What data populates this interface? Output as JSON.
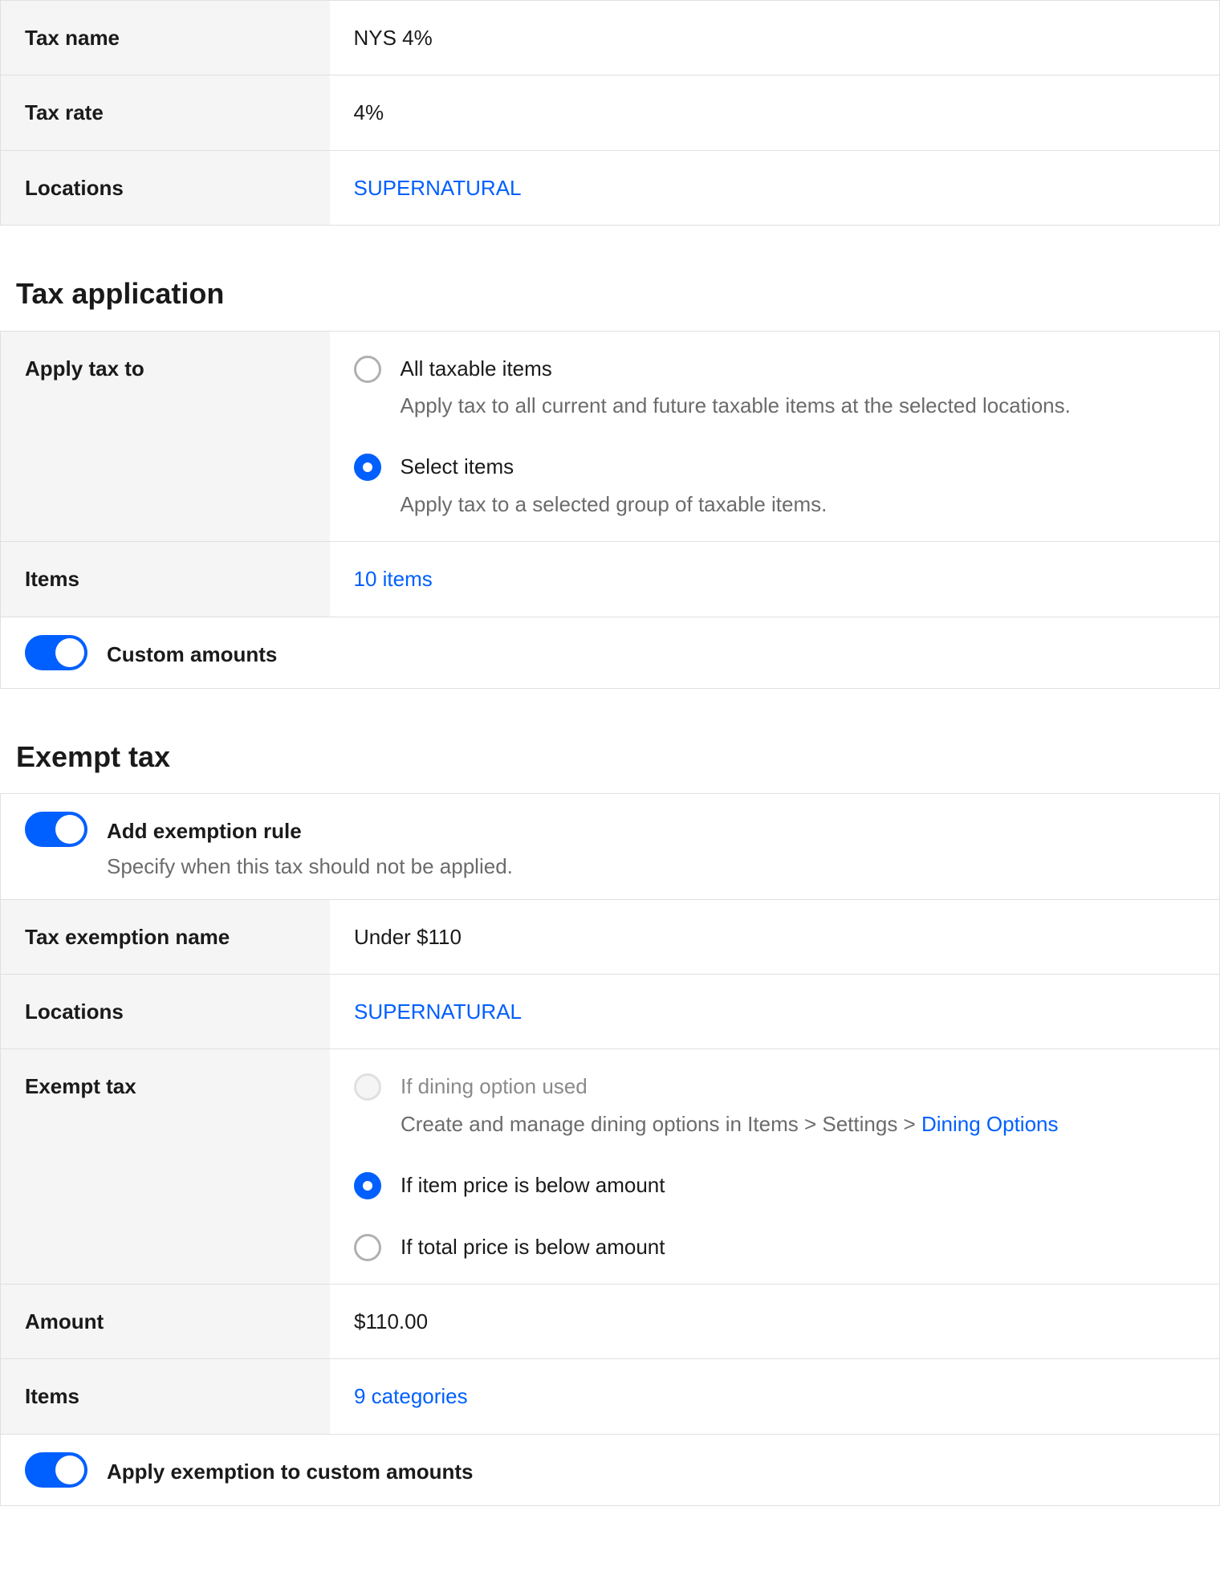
{
  "top": {
    "rows": {
      "tax_name_label": "Tax name",
      "tax_name_value": "NYS 4%",
      "tax_rate_label": "Tax rate",
      "tax_rate_value": "4%",
      "locations_label": "Locations",
      "locations_value": "SUPERNATURAL"
    }
  },
  "application": {
    "title": "Tax application",
    "apply_to_label": "Apply tax to",
    "option_all": {
      "label": "All taxable items",
      "desc": "Apply tax to all current and future taxable items at the selected locations."
    },
    "option_select": {
      "label": "Select items",
      "desc": "Apply tax to a selected group of taxable items."
    },
    "items_label": "Items",
    "items_value": "10 items",
    "custom_amounts_label": "Custom amounts"
  },
  "exempt": {
    "title": "Exempt tax",
    "add_rule_label": "Add exemption rule",
    "add_rule_desc": "Specify when this tax should not be applied.",
    "exemption_name_label": "Tax exemption name",
    "exemption_name_value": "Under $110",
    "locations_label": "Locations",
    "locations_value": "SUPERNATURAL",
    "exempt_tax_label": "Exempt tax",
    "option_dining": {
      "label": "If dining option used",
      "desc_prefix": "Create and manage dining options in Items > Settings > ",
      "desc_link": "Dining Options"
    },
    "option_item_price": {
      "label": "If item price is below amount"
    },
    "option_total_price": {
      "label": "If total price is below amount"
    },
    "amount_label": "Amount",
    "amount_value": "$110.00",
    "items_label": "Items",
    "items_value": "9 categories",
    "apply_custom_label": "Apply exemption to custom amounts"
  }
}
